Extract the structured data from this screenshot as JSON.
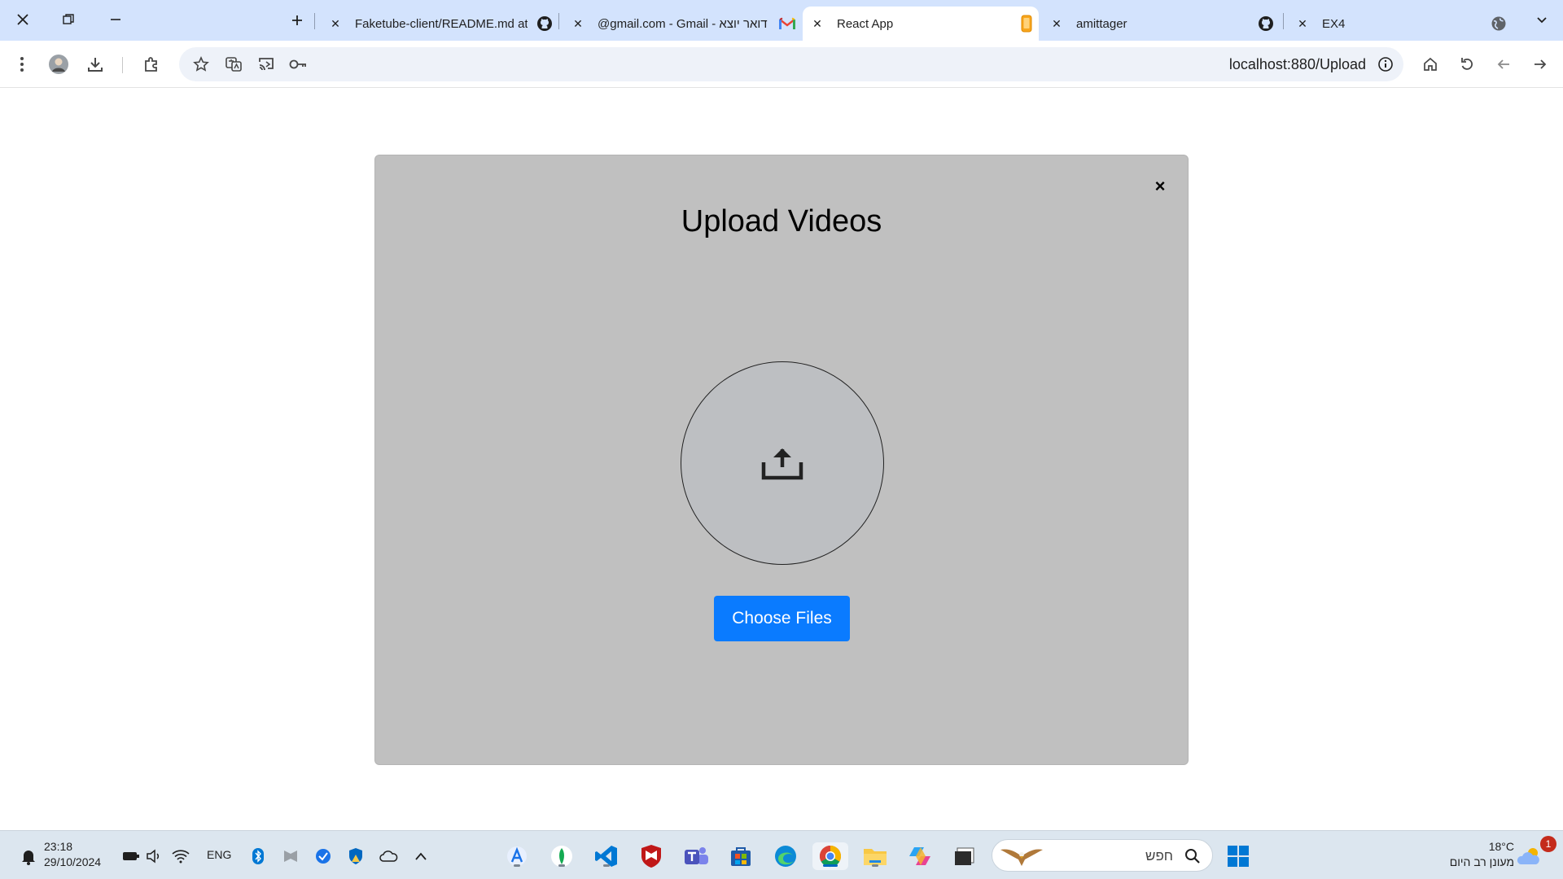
{
  "browser": {
    "tabs": [
      {
        "title": "Faketube-client/README.md at",
        "icon": "github-icon"
      },
      {
        "title": "@gmail.com - Gmail - דואר יוצא",
        "icon": "gmail-icon"
      },
      {
        "title": "React App",
        "icon": "react-app-icon",
        "active": true
      },
      {
        "title": "amittager",
        "icon": "github-icon"
      },
      {
        "title": "EX4",
        "icon": "globe-icon"
      }
    ],
    "url": "localhost:880/Upload"
  },
  "modal": {
    "title": "Upload Videos",
    "close_label": "×",
    "choose_files_label": "Choose Files"
  },
  "taskbar": {
    "time": "23:18",
    "date": "29/10/2024",
    "language": "ENG",
    "search_placeholder": "חפש",
    "weather_temp": "18°C",
    "weather_desc": "מעונן רב היום",
    "notification_count": "1"
  },
  "colors": {
    "accent": "#0a7bff",
    "modal_bg": "#c0c0c0",
    "tabstrip_bg": "#d3e3fd"
  }
}
